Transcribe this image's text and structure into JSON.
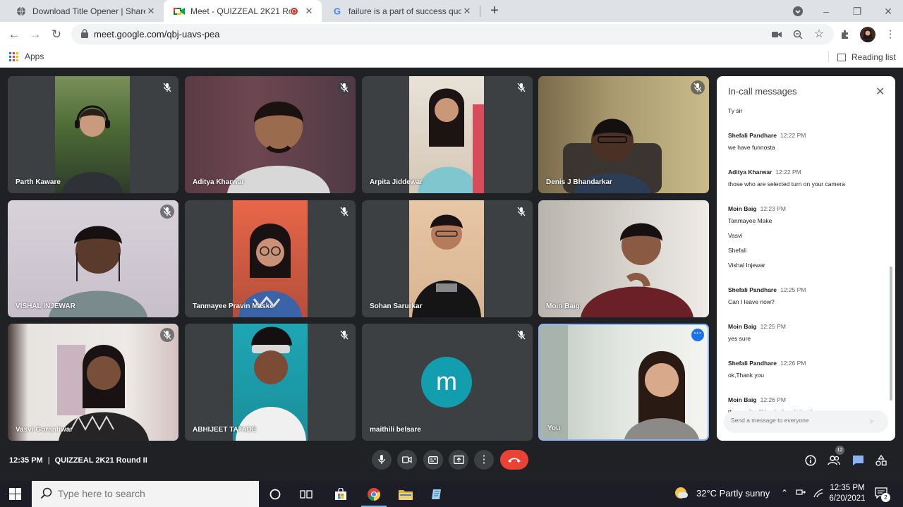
{
  "browser": {
    "tabs": [
      {
        "title": "Download Title Opener | Shared by",
        "active": false
      },
      {
        "title": "Meet - QUIZZEAL 2K21 Round II",
        "active": true
      },
      {
        "title": "failure is a part of success quotes",
        "active": false
      }
    ],
    "url": "meet.google.com/qbj-uavs-pea",
    "bookmarks": {
      "apps_label": "Apps",
      "reading_list_label": "Reading list"
    }
  },
  "participants": [
    {
      "name": "Parth Kaware",
      "muted": true
    },
    {
      "name": "Aditya Kharwar",
      "muted": true
    },
    {
      "name": "Arpita Jiddewar",
      "muted": true
    },
    {
      "name": "Denis J Bhandarkar",
      "muted": true
    },
    {
      "name": "VISHAL INJEWAR",
      "muted": true
    },
    {
      "name": "Tanmayee Pravin Maske",
      "muted": true
    },
    {
      "name": "Sohan Sarurkar",
      "muted": true
    },
    {
      "name": "Moin Baig",
      "muted": false
    },
    {
      "name": "Vasvi Gorantiwar",
      "muted": true
    },
    {
      "name": "ABHIJEET TATADE",
      "muted": true
    },
    {
      "name": "maithili belsare",
      "muted": true,
      "avatar_letter": "m"
    },
    {
      "name": "You",
      "muted": false
    }
  ],
  "chat": {
    "title": "In-call messages",
    "first_line": "Ty sir",
    "messages": [
      {
        "sender": "Shefali Pandhare",
        "time": "12:22 PM",
        "lines": [
          "we have funnosta"
        ]
      },
      {
        "sender": "Aditya Kharwar",
        "time": "12:22 PM",
        "lines": [
          "those who are selected turn on your camera"
        ]
      },
      {
        "sender": "Moin Baig",
        "time": "12:23 PM",
        "lines": [
          "Tanmayee Make",
          "Vasvi",
          "Shefali",
          "Vishal Injewar"
        ]
      },
      {
        "sender": "Shefali Pandhare",
        "time": "12:25 PM",
        "lines": [
          "Can I leave now?"
        ]
      },
      {
        "sender": "Moin Baig",
        "time": "12:25 PM",
        "lines": [
          "yes sure"
        ]
      },
      {
        "sender": "Shefali Pandhare",
        "time": "12:26 PM",
        "lines": [
          "ok,Thank you"
        ]
      },
      {
        "sender": "Moin Baig",
        "time": "12:26 PM",
        "lines": [
          "the result will be declared shortly"
        ]
      }
    ],
    "input_placeholder": "Send a message to everyone"
  },
  "meeting": {
    "time": "12:35 PM",
    "title": "QUIZZEAL 2K21 Round II",
    "participant_count": "12"
  },
  "taskbar": {
    "search_placeholder": "Type here to search",
    "weather": "32°C  Partly sunny",
    "clock_time": "12:35 PM",
    "clock_date": "6/20/2021",
    "notification_count": "2"
  },
  "colors": {
    "meet_background": "#202124",
    "tile_background": "#3c4043",
    "avatar_teal": "#129eaf",
    "end_call_red": "#ea4335",
    "highlight_blue": "#8ab4f8"
  }
}
